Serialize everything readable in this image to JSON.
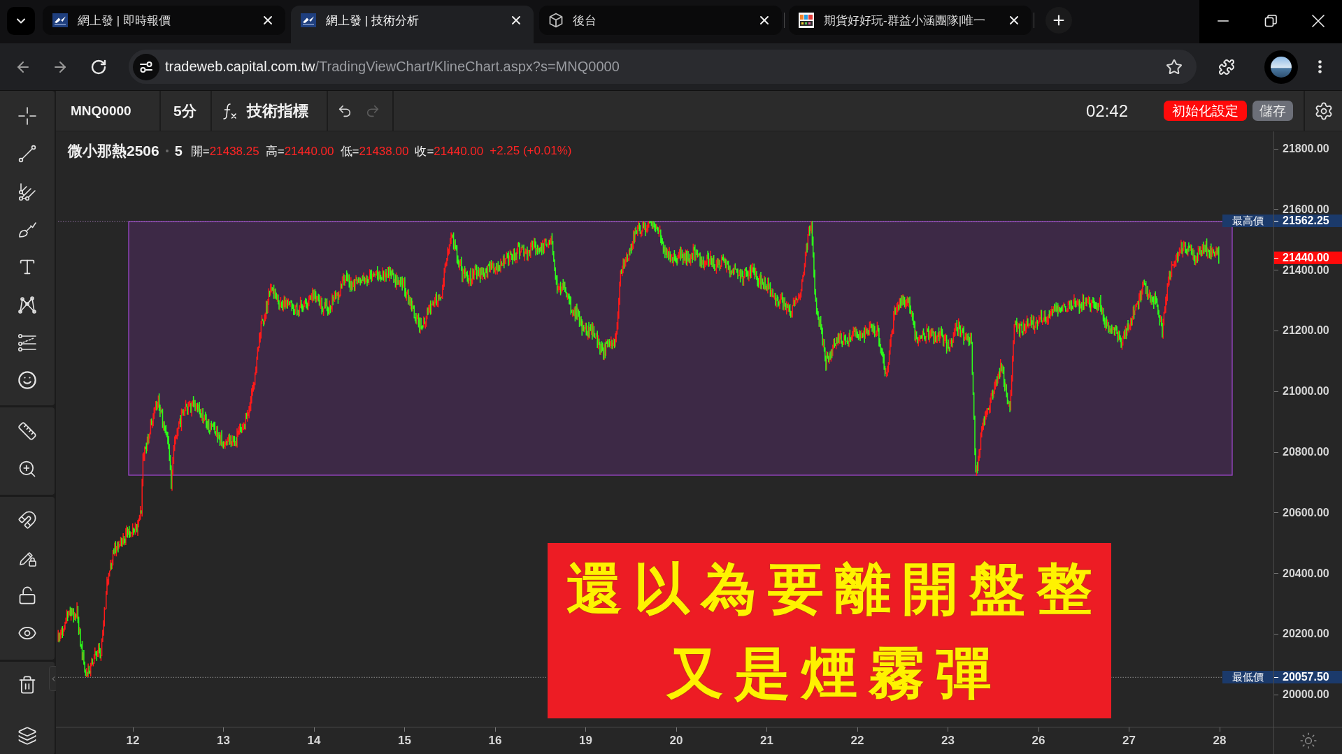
{
  "browser": {
    "tabs": [
      {
        "title": "網上發 | 即時報價",
        "kind": "brand",
        "selected": false
      },
      {
        "title": "網上發 | 技術分析",
        "kind": "brand",
        "selected": true
      },
      {
        "title": "後台",
        "kind": "cube",
        "selected": false
      },
      {
        "title": "期貨好好玩-群益小涵團隊|唯一",
        "kind": "tile",
        "selected": false
      }
    ],
    "url": {
      "host": "tradeweb.capital.com.tw",
      "path": "/TradingViewChart/KlineChart.aspx?s=MNQ0000"
    }
  },
  "toolbar": {
    "symbol": "MNQ0000",
    "interval": "5分",
    "indicators": "技術指標",
    "undo": {
      "disabled": false
    },
    "redo": {
      "disabled": true
    },
    "clock": "02:42",
    "reset_button": "初始化設定",
    "save_button": "儲存"
  },
  "legend": {
    "name": "微小那熱2506",
    "interval": "5",
    "fields": [
      {
        "label": "開=",
        "value": "21438.25"
      },
      {
        "label": "高=",
        "value": "21440.00"
      },
      {
        "label": "低=",
        "value": "21438.00"
      },
      {
        "label": "收=",
        "value": "21440.00"
      }
    ],
    "change": "+2.25 (+0.01%)"
  },
  "price_axis": {
    "labels": [
      "21800.00",
      "21600.00",
      "21400.00",
      "21200.00",
      "21000.00",
      "20800.00",
      "20600.00",
      "20400.00",
      "20200.00",
      "20000.00"
    ],
    "markers": [
      {
        "kind": "high",
        "label": "最高價",
        "value": "21562.25"
      },
      {
        "kind": "last",
        "value": "21440.00"
      },
      {
        "kind": "low",
        "label": "最低價",
        "value": "20057.50"
      }
    ]
  },
  "time_axis": {
    "labels": [
      "12",
      "13",
      "14",
      "15",
      "16",
      "19",
      "20",
      "21",
      "22",
      "23",
      "26",
      "27",
      "28"
    ]
  },
  "banner": {
    "lines": [
      "還以為要離開盤整",
      "又是煙霧彈"
    ]
  }
}
